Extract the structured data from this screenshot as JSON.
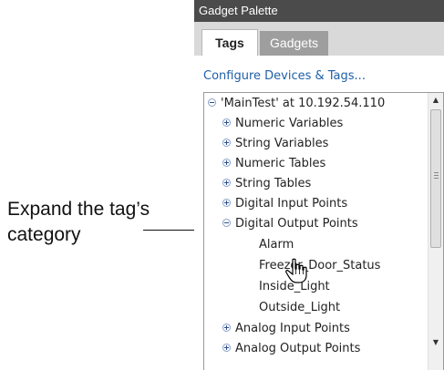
{
  "callout": {
    "line1": "Expand the tag’s",
    "line2": "category"
  },
  "palette": {
    "title": "Gadget Palette",
    "tabs": [
      {
        "label": "Tags",
        "selected": true
      },
      {
        "label": "Gadgets",
        "selected": false
      }
    ],
    "config_link": "Configure Devices & Tags...",
    "tree": {
      "root": "'MainTest' at 10.192.54.110",
      "categories": [
        {
          "label": "Numeric Variables",
          "state": "collapsed"
        },
        {
          "label": "String Variables",
          "state": "collapsed"
        },
        {
          "label": "Numeric Tables",
          "state": "collapsed"
        },
        {
          "label": "String Tables",
          "state": "collapsed"
        },
        {
          "label": "Digital Input Points",
          "state": "collapsed"
        },
        {
          "label": "Digital Output Points",
          "state": "expanded"
        },
        {
          "label": "Analog Input Points",
          "state": "collapsed"
        },
        {
          "label": "Analog Output Points",
          "state": "collapsed"
        }
      ],
      "digital_output_children": [
        "Alarm",
        "Freezer_Door_Status",
        "Inside_Light",
        "Outside_Light"
      ]
    }
  },
  "icons": {
    "expand": "plus-circle-icon",
    "collapse": "minus-circle-icon",
    "cursor": "hand-pointer-icon"
  },
  "colors": {
    "title_bar": "#4b4b4b",
    "tab_bar": "#d9d9d9",
    "inactive_tab": "#9e9e9e",
    "link": "#1f5fa8"
  }
}
